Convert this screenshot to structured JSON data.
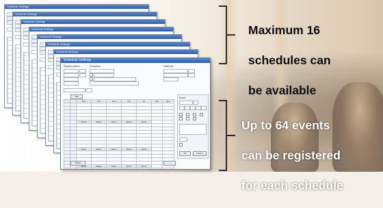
{
  "window": {
    "title": "Schedule Settings",
    "sections": {
      "repeat": "Repeat pattern",
      "exception": "Exception",
      "calendar": "Calendar",
      "event": "Event"
    },
    "day_headers": [
      "Mon",
      "Tue",
      "Wed",
      "Thu",
      "Fri",
      "Sat",
      "Sun"
    ],
    "event_cell_label": "Event",
    "buttons": {
      "add": "Add",
      "delete": "Delete",
      "ok": "OK",
      "cancel": "Cancel"
    }
  },
  "callouts": {
    "top": [
      "Maximum 16",
      "schedules can",
      "be available"
    ],
    "bottom": [
      "Up to 64 events",
      "can be registered",
      "for each schedule"
    ]
  },
  "colors": {
    "titlebar": "#2f5da6",
    "callout_dark": "#0d0d0d",
    "callout_light": "#ffffff"
  }
}
